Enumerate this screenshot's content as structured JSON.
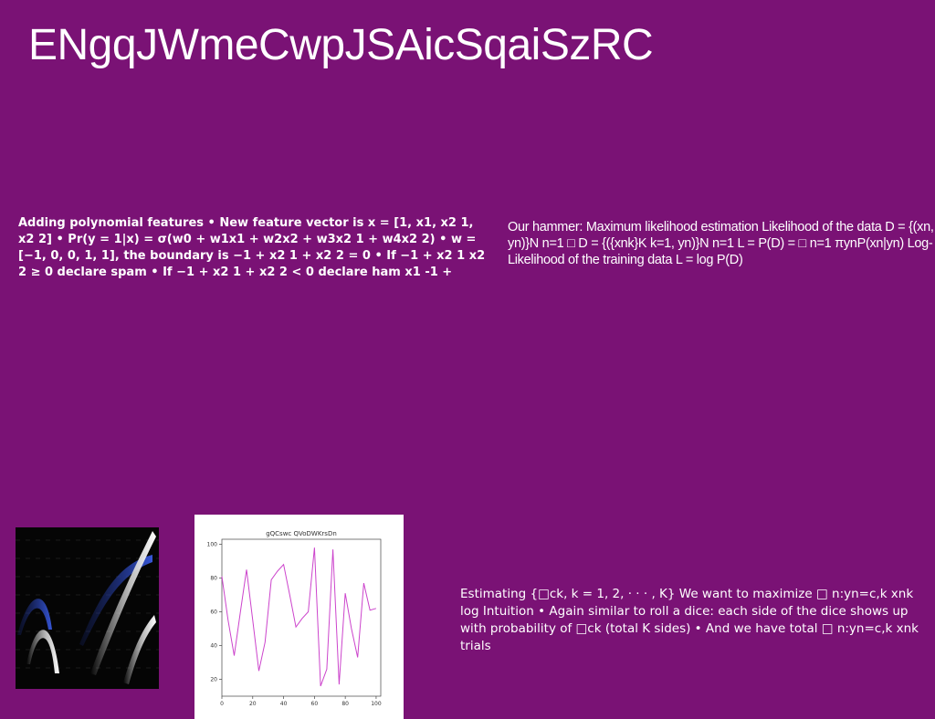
{
  "slide": {
    "title": "ENgqJWmeCwpJSAicSqaiSzRC",
    "left_text": "Adding polynomial features • New feature vector is x = [1, x1, x2 1, x2 2] • Pr(y = 1|x) = σ(w0 + w1x1 + w2x2 + w3x2 1 + w4x2 2) • w = [−1, 0, 0, 1, 1], the boundary is −1 + x2 1 + x2 2 = 0 • If −1 + x2 1 x2 2 ≥ 0 declare spam • If −1 + x2 1 + x2 2 < 0 declare ham x1 -1 +",
    "right_text": "Our hammer: Maximum likelihood estimation Likelihood of the data D = {(xn, yn)}N n=1 □ D = {({xnk}K k=1, yn)}N n=1 L = P(D) = □ n=1 πynP(xn|yn) Log-Likelihood of the training data L = log P(D)",
    "bottom_text": "Estimating {□ck, k = 1, 2, · · · , K} We want to maximize □ n:yn=c,k xnk log Intuition • Again similar to roll a dice: each side of the dice shows up with probability of □ck (total K sides) • And we have total □ n:yn=c,k xnk trials"
  },
  "colors": {
    "background": "#7a1275",
    "text": "#ffffff",
    "line": "#cc44cc"
  },
  "chart_data": {
    "type": "line",
    "title": "gQCswc QVoDWKrsDn",
    "xlabel": "",
    "ylabel": "",
    "xlim": [
      0,
      103
    ],
    "ylim": [
      10,
      103
    ],
    "xticks": [
      0,
      20,
      40,
      60,
      80,
      100
    ],
    "yticks": [
      20,
      40,
      60,
      80,
      100
    ],
    "grid": false,
    "series": [
      {
        "x": [
          0,
          4,
          8,
          12,
          16,
          20,
          24,
          28,
          32,
          36,
          40,
          44,
          48,
          52,
          56,
          60,
          64,
          68,
          72,
          76,
          80,
          84,
          88,
          92,
          96,
          100
        ],
        "y": [
          81,
          55,
          34,
          60,
          85,
          55,
          25,
          42,
          79,
          84,
          88,
          70,
          51,
          56,
          60,
          98,
          16,
          26,
          97,
          17,
          71,
          50,
          33,
          77,
          61,
          62
        ]
      }
    ]
  }
}
